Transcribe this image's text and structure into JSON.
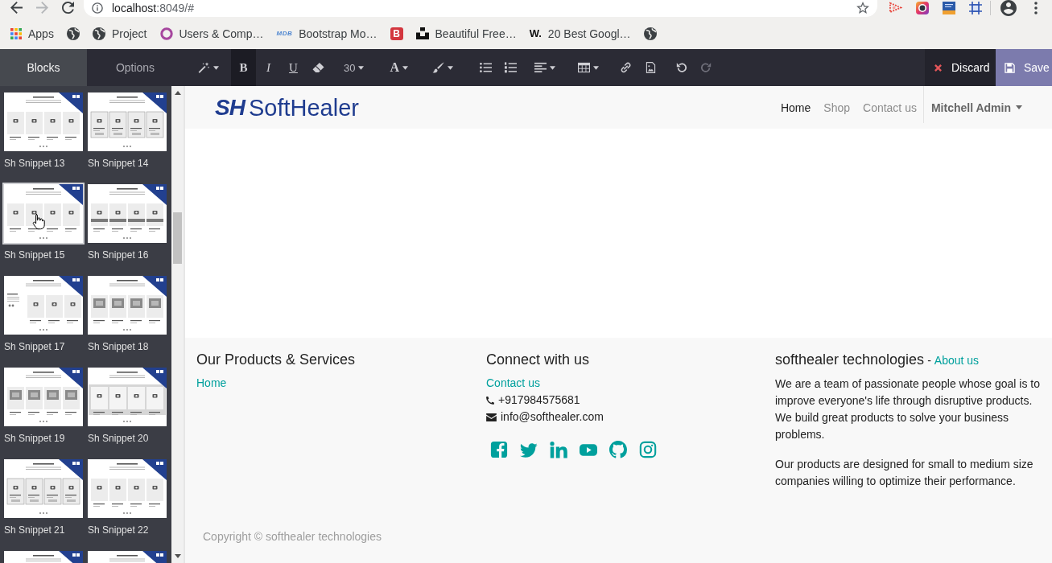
{
  "browser": {
    "nav_buttons": [
      {
        "kind": "back",
        "disabled": false
      },
      {
        "kind": "forward",
        "disabled": true
      },
      {
        "kind": "reload",
        "disabled": false
      }
    ],
    "address": {
      "host": "localhost",
      "rest": ":8049/#"
    },
    "bookmarks": [
      {
        "kind": "apps",
        "label": "Apps"
      },
      {
        "kind": "globe"
      },
      {
        "kind": "globe",
        "label": "Project"
      },
      {
        "kind": "ring",
        "label": "Users & Comp…"
      },
      {
        "kind": "wordmark",
        "mark": "MDB",
        "label": "Bootstrap Mo…"
      },
      {
        "kind": "tile",
        "mark": "B"
      },
      {
        "kind": "blocks",
        "label": "Beautiful Free…"
      },
      {
        "kind": "letters",
        "mark": "W.",
        "label": "20 Best Googl…"
      },
      {
        "kind": "globe"
      }
    ]
  },
  "editor": {
    "tabs": [
      {
        "label": "Blocks",
        "selected": true
      },
      {
        "label": "Options",
        "selected": false
      }
    ],
    "tool_groups": [
      {
        "tools": [
          {
            "kind": "wand",
            "caret": true,
            "active": false,
            "disabled": false
          }
        ]
      },
      {
        "tools": [
          {
            "kind": "bold",
            "label": "B",
            "caret": false,
            "active": true,
            "disabled": false
          },
          {
            "kind": "italic",
            "label": "I",
            "caret": false,
            "active": false,
            "disabled": false
          },
          {
            "kind": "underline",
            "label": "U",
            "caret": false,
            "active": false,
            "disabled": false
          },
          {
            "kind": "eraser",
            "caret": false,
            "active": false,
            "disabled": false
          }
        ]
      },
      {
        "tools": [
          {
            "kind": "size",
            "label": "30",
            "caret": true,
            "active": false,
            "disabled": false
          }
        ]
      },
      {
        "tools": [
          {
            "kind": "color",
            "label": "A",
            "caret": true,
            "active": false,
            "disabled": false
          }
        ]
      },
      {
        "tools": [
          {
            "kind": "brush",
            "caret": true,
            "active": false,
            "disabled": false
          }
        ]
      },
      {
        "tools": [
          {
            "kind": "bullets",
            "caret": false,
            "active": false,
            "disabled": false
          },
          {
            "kind": "numbers",
            "caret": false,
            "active": false,
            "disabled": false
          }
        ]
      },
      {
        "tools": [
          {
            "kind": "align",
            "caret": true,
            "active": false,
            "disabled": false
          }
        ]
      },
      {
        "tools": [
          {
            "kind": "table",
            "caret": true,
            "active": false,
            "disabled": false
          }
        ]
      },
      {
        "tools": [
          {
            "kind": "link",
            "caret": false,
            "active": false,
            "disabled": false
          },
          {
            "kind": "image",
            "caret": false,
            "active": false,
            "disabled": false
          }
        ]
      },
      {
        "tools": [
          {
            "kind": "undo",
            "caret": false,
            "active": false,
            "disabled": false
          },
          {
            "kind": "redo",
            "caret": false,
            "active": false,
            "disabled": true
          }
        ]
      }
    ],
    "actions": {
      "discard": "Discard",
      "save": "Save"
    }
  },
  "snippets": [
    {
      "label": "Sh Snippet 13",
      "kind": "grid",
      "hovered": false
    },
    {
      "label": "Sh Snippet 14",
      "kind": "framed",
      "hovered": false
    },
    {
      "label": "Sh Snippet 15",
      "kind": "grid",
      "hovered": true
    },
    {
      "label": "Sh Snippet 16",
      "kind": "banded",
      "hovered": false
    },
    {
      "label": "Sh Snippet 17",
      "kind": "aside",
      "hovered": false
    },
    {
      "label": "Sh Snippet 18",
      "kind": "dark",
      "hovered": false
    },
    {
      "label": "Sh Snippet 19",
      "kind": "dark",
      "hovered": false
    },
    {
      "label": "Sh Snippet 20",
      "kind": "panel",
      "hovered": false
    },
    {
      "label": "Sh Snippet 21",
      "kind": "framed",
      "hovered": false
    },
    {
      "label": "Sh Snippet 22",
      "kind": "grid",
      "hovered": false
    },
    {
      "kind": "grid",
      "hovered": false
    },
    {
      "kind": "grid",
      "hovered": false
    }
  ],
  "site": {
    "logo": {
      "mark": "SH",
      "text": "SoftHealer"
    },
    "nav": [
      {
        "label": "Home",
        "selected": true
      },
      {
        "label": "Shop",
        "selected": false
      },
      {
        "label": "Contact us",
        "selected": false
      }
    ],
    "user": "Mitchell Admin"
  },
  "footer": {
    "products": {
      "title": "Our Products & Services",
      "links": [
        "Home"
      ]
    },
    "connect": {
      "title": "Connect with us",
      "links": [
        "Contact us"
      ],
      "contacts": [
        {
          "kind": "phone",
          "text": "+917984575681"
        },
        {
          "kind": "email",
          "text": "info@softhealer.com"
        }
      ],
      "social": [
        {
          "kind": "facebook"
        },
        {
          "kind": "twitter"
        },
        {
          "kind": "linkedin"
        },
        {
          "kind": "youtube"
        },
        {
          "kind": "github"
        },
        {
          "kind": "instagram"
        }
      ]
    },
    "about": {
      "title": "softhealer technologies",
      "separator": "-",
      "link": "About us",
      "paragraphs": [
        "We are a team of passionate people whose goal is to improve everyone's life through disruptive products. We build great products to solve your business problems.",
        "Our products are designed for small to medium size companies willing to optimize their performance."
      ]
    },
    "copyright": "Copyright © softhealer technologies"
  }
}
